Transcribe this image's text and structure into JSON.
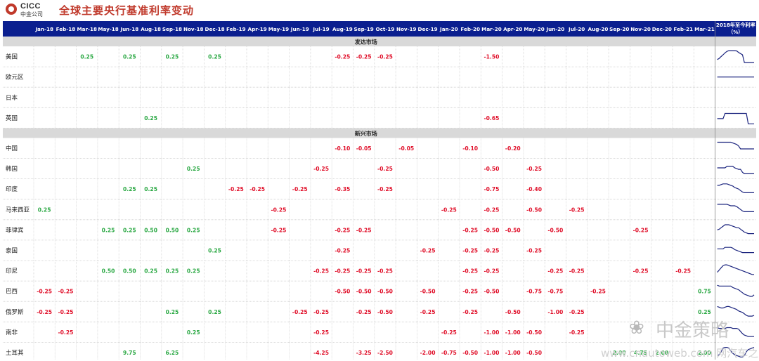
{
  "header": {
    "logo_en": "CICC",
    "logo_cn": "中金公司",
    "title": "全球主要央行基准利率变动"
  },
  "chart_data": {
    "type": "table",
    "columns": [
      "Jan-18",
      "Feb-18",
      "Mar-18",
      "May-18",
      "Jun-18",
      "Aug-18",
      "Sep-18",
      "Nov-18",
      "Dec-18",
      "Feb-19",
      "Apr-19",
      "May-19",
      "Jun-19",
      "Jul-19",
      "Aug-19",
      "Sep-19",
      "Oct-19",
      "Nov-19",
      "Dec-19",
      "Jan-20",
      "Feb-20",
      "Mar-20",
      "Apr-20",
      "May-20",
      "Jun-20",
      "Jul-20",
      "Aug-20",
      "Sep-20",
      "Nov-20",
      "Dec-20",
      "Feb-21",
      "Mar-21"
    ],
    "last_column": "2018年至今利率（%）",
    "sections": [
      {
        "name": "发达市场",
        "rows": [
          {
            "label": "美国",
            "values": [
              "",
              "",
              "0.25",
              "",
              "0.25",
              "",
              "0.25",
              "",
              "0.25",
              "",
              "",
              "",
              "",
              "",
              "-0.25",
              "-0.25",
              "-0.25",
              "",
              "",
              "",
              "",
              "-1.50",
              "",
              "",
              "",
              "",
              "",
              "",
              "",
              "",
              "",
              ""
            ],
            "trend": [
              0.3,
              0.38,
              0.5,
              0.62,
              0.75,
              0.85,
              0.9,
              0.9,
              0.9,
              0.9,
              0.88,
              0.78,
              0.7,
              0.62,
              0.1,
              0.1,
              0.1,
              0.1,
              0.1,
              0.1
            ]
          },
          {
            "label": "欧元区",
            "values": [
              "",
              "",
              "",
              "",
              "",
              "",
              "",
              "",
              "",
              "",
              "",
              "",
              "",
              "",
              "",
              "",
              "",
              "",
              "",
              "",
              "",
              "",
              "",
              "",
              "",
              "",
              "",
              "",
              "",
              "",
              "",
              ""
            ],
            "trend": [
              0.5,
              0.5,
              0.5,
              0.5,
              0.5,
              0.5,
              0.5,
              0.5,
              0.5,
              0.5,
              0.5,
              0.5,
              0.5,
              0.5,
              0.5,
              0.5,
              0.5,
              0.5,
              0.5,
              0.5
            ]
          },
          {
            "label": "日本",
            "values": [
              "",
              "",
              "",
              "",
              "",
              "",
              "",
              "",
              "",
              "",
              "",
              "",
              "",
              "",
              "",
              "",
              "",
              "",
              "",
              "",
              "",
              "",
              "",
              "",
              "",
              "",
              "",
              "",
              "",
              "",
              "",
              ""
            ],
            "trend": []
          },
          {
            "label": "英国",
            "values": [
              "",
              "",
              "",
              "",
              "",
              "0.25",
              "",
              "",
              "",
              "",
              "",
              "",
              "",
              "",
              "",
              "",
              "",
              "",
              "",
              "",
              "",
              "-0.65",
              "",
              "",
              "",
              "",
              "",
              "",
              "",
              "",
              "",
              ""
            ],
            "trend": [
              0.45,
              0.45,
              0.45,
              0.45,
              0.8,
              0.8,
              0.8,
              0.8,
              0.8,
              0.8,
              0.8,
              0.8,
              0.8,
              0.8,
              0.8,
              0.8,
              0.1,
              0.1,
              0.1,
              0.1
            ]
          }
        ]
      },
      {
        "name": "新兴市场",
        "rows": [
          {
            "label": "中国",
            "values": [
              "",
              "",
              "",
              "",
              "",
              "",
              "",
              "",
              "",
              "",
              "",
              "",
              "",
              "",
              "-0.10",
              "-0.05",
              "",
              "-0.05",
              "",
              "",
              "-0.10",
              "",
              "-0.20",
              "",
              "",
              "",
              "",
              "",
              "",
              "",
              "",
              ""
            ],
            "trend": [
              0.9,
              0.9,
              0.9,
              0.9,
              0.9,
              0.9,
              0.9,
              0.9,
              0.85,
              0.8,
              0.75,
              0.65,
              0.45,
              0.45,
              0.45,
              0.45,
              0.45,
              0.45,
              0.45,
              0.45
            ]
          },
          {
            "label": "韩国",
            "values": [
              "",
              "",
              "",
              "",
              "",
              "",
              "",
              "0.25",
              "",
              "",
              "",
              "",
              "",
              "-0.25",
              "",
              "",
              "-0.25",
              "",
              "",
              "",
              "",
              "-0.50",
              "",
              "-0.25",
              "",
              "",
              "",
              "",
              "",
              "",
              "",
              ""
            ],
            "trend": [
              0.55,
              0.55,
              0.55,
              0.55,
              0.55,
              0.65,
              0.65,
              0.65,
              0.65,
              0.55,
              0.5,
              0.45,
              0.45,
              0.25,
              0.15,
              0.15,
              0.15,
              0.15,
              0.15,
              0.15
            ]
          },
          {
            "label": "印度",
            "values": [
              "",
              "",
              "",
              "",
              "0.25",
              "0.25",
              "",
              "",
              "",
              "-0.25",
              "-0.25",
              "",
              "-0.25",
              "",
              "-0.35",
              "",
              "-0.25",
              "",
              "",
              "",
              "",
              "-0.75",
              "",
              "-0.40",
              "",
              "",
              "",
              "",
              "",
              "",
              "",
              ""
            ],
            "trend": [
              0.75,
              0.75,
              0.8,
              0.85,
              0.85,
              0.85,
              0.8,
              0.75,
              0.7,
              0.6,
              0.55,
              0.5,
              0.4,
              0.3,
              0.25,
              0.25,
              0.25,
              0.25,
              0.25,
              0.25
            ]
          },
          {
            "label": "马来西亚",
            "values": [
              "0.25",
              "",
              "",
              "",
              "",
              "",
              "",
              "",
              "",
              "",
              "",
              "-0.25",
              "",
              "",
              "",
              "",
              "",
              "",
              "",
              "-0.25",
              "",
              "-0.25",
              "",
              "-0.50",
              "",
              "-0.25",
              "",
              "",
              "",
              "",
              "",
              ""
            ],
            "trend": [
              0.85,
              0.85,
              0.85,
              0.85,
              0.85,
              0.85,
              0.8,
              0.75,
              0.75,
              0.75,
              0.7,
              0.6,
              0.5,
              0.4,
              0.35,
              0.35,
              0.35,
              0.35,
              0.35,
              0.35
            ]
          },
          {
            "label": "菲律宾",
            "values": [
              "",
              "",
              "",
              "0.25",
              "0.25",
              "0.50",
              "0.50",
              "0.25",
              "",
              "",
              "",
              "-0.25",
              "",
              "",
              "-0.25",
              "-0.25",
              "",
              "",
              "",
              "",
              "-0.25",
              "-0.50",
              "-0.50",
              "",
              "-0.50",
              "",
              "",
              "",
              "-0.25",
              "",
              "",
              ""
            ],
            "trend": [
              0.5,
              0.55,
              0.65,
              0.75,
              0.85,
              0.85,
              0.85,
              0.8,
              0.75,
              0.7,
              0.65,
              0.65,
              0.55,
              0.45,
              0.35,
              0.3,
              0.25,
              0.25,
              0.25,
              0.25
            ]
          },
          {
            "label": "泰国",
            "values": [
              "",
              "",
              "",
              "",
              "",
              "",
              "",
              "",
              "0.25",
              "",
              "",
              "",
              "",
              "",
              "-0.25",
              "",
              "",
              "",
              "-0.25",
              "",
              "-0.25",
              "-0.25",
              "",
              "-0.25",
              "",
              "",
              "",
              "",
              "",
              "",
              "",
              ""
            ],
            "trend": [
              0.6,
              0.6,
              0.6,
              0.6,
              0.7,
              0.7,
              0.7,
              0.7,
              0.65,
              0.55,
              0.5,
              0.45,
              0.4,
              0.35,
              0.35,
              0.35,
              0.35,
              0.35,
              0.35,
              0.35
            ]
          },
          {
            "label": "印尼",
            "values": [
              "",
              "",
              "",
              "0.50",
              "0.50",
              "0.25",
              "0.25",
              "0.25",
              "",
              "",
              "",
              "",
              "",
              "-0.25",
              "-0.25",
              "-0.25",
              "-0.25",
              "",
              "",
              "",
              "-0.25",
              "-0.25",
              "",
              "",
              "-0.25",
              "-0.25",
              "",
              "",
              "-0.25",
              "",
              "-0.25",
              ""
            ],
            "trend": [
              0.4,
              0.55,
              0.7,
              0.85,
              0.9,
              0.9,
              0.85,
              0.8,
              0.75,
              0.7,
              0.65,
              0.6,
              0.55,
              0.5,
              0.45,
              0.4,
              0.35,
              0.3,
              0.25,
              0.25
            ]
          },
          {
            "label": "巴西",
            "values": [
              "-0.25",
              "-0.25",
              "",
              "",
              "",
              "",
              "",
              "",
              "",
              "",
              "",
              "",
              "",
              "",
              "-0.50",
              "-0.50",
              "-0.50",
              "",
              "-0.50",
              "",
              "-0.25",
              "-0.50",
              "",
              "-0.75",
              "-0.75",
              "",
              "-0.25",
              "",
              "",
              "",
              "",
              "0.75"
            ],
            "trend": [
              0.9,
              0.85,
              0.85,
              0.85,
              0.85,
              0.85,
              0.85,
              0.85,
              0.75,
              0.7,
              0.65,
              0.6,
              0.5,
              0.4,
              0.3,
              0.25,
              0.2,
              0.15,
              0.15,
              0.25
            ]
          },
          {
            "label": "俄罗斯",
            "values": [
              "-0.25",
              "-0.25",
              "",
              "",
              "",
              "",
              "0.25",
              "",
              "0.25",
              "",
              "",
              "",
              "-0.25",
              "-0.25",
              "",
              "-0.25",
              "-0.50",
              "",
              "-0.25",
              "",
              "-0.25",
              "",
              "-0.50",
              "",
              "-1.00",
              "-0.25",
              "",
              "",
              "",
              "",
              "",
              "0.25"
            ],
            "trend": [
              0.85,
              0.8,
              0.75,
              0.75,
              0.8,
              0.85,
              0.85,
              0.8,
              0.75,
              0.7,
              0.65,
              0.55,
              0.5,
              0.45,
              0.35,
              0.25,
              0.2,
              0.2,
              0.2,
              0.25
            ]
          },
          {
            "label": "南非",
            "values": [
              "",
              "-0.25",
              "",
              "",
              "",
              "",
              "",
              "0.25",
              "",
              "",
              "",
              "",
              "",
              "-0.25",
              "",
              "",
              "",
              "",
              "",
              "-0.25",
              "",
              "-1.00",
              "-1.00",
              "-0.50",
              "",
              "-0.25",
              "",
              "",
              "",
              "",
              "",
              ""
            ],
            "trend": [
              0.8,
              0.75,
              0.75,
              0.75,
              0.75,
              0.8,
              0.8,
              0.8,
              0.75,
              0.75,
              0.75,
              0.7,
              0.55,
              0.4,
              0.3,
              0.25,
              0.2,
              0.2,
              0.2,
              0.2
            ]
          },
          {
            "label": "土耳其",
            "values": [
              "",
              "",
              "",
              "",
              "9.75",
              "",
              "6.25",
              "",
              "",
              "",
              "",
              "",
              "",
              "-4.25",
              "",
              "-3.25",
              "-2.50",
              "",
              "-2.00",
              "-0.75",
              "-0.50",
              "-1.00",
              "-1.00",
              "-0.50",
              "",
              "",
              "",
              "2.00",
              "4.75",
              "2.00",
              "",
              "2.00"
            ],
            "trend": [
              0.3,
              0.35,
              0.55,
              0.8,
              0.85,
              0.85,
              0.8,
              0.6,
              0.45,
              0.35,
              0.3,
              0.25,
              0.2,
              0.2,
              0.3,
              0.55,
              0.7,
              0.75,
              0.8,
              0.85
            ]
          }
        ]
      }
    ]
  },
  "watermark": {
    "name": "中金策略",
    "url": "www.cnautoweb.com 网汽车之家"
  },
  "colors": {
    "header_bg": "#0b1f8f",
    "section_bg": "#d9d9d9",
    "positive": "#2aa843",
    "negative": "#e0102a",
    "trend_line": "#1a237e",
    "title": "#c0392b"
  }
}
